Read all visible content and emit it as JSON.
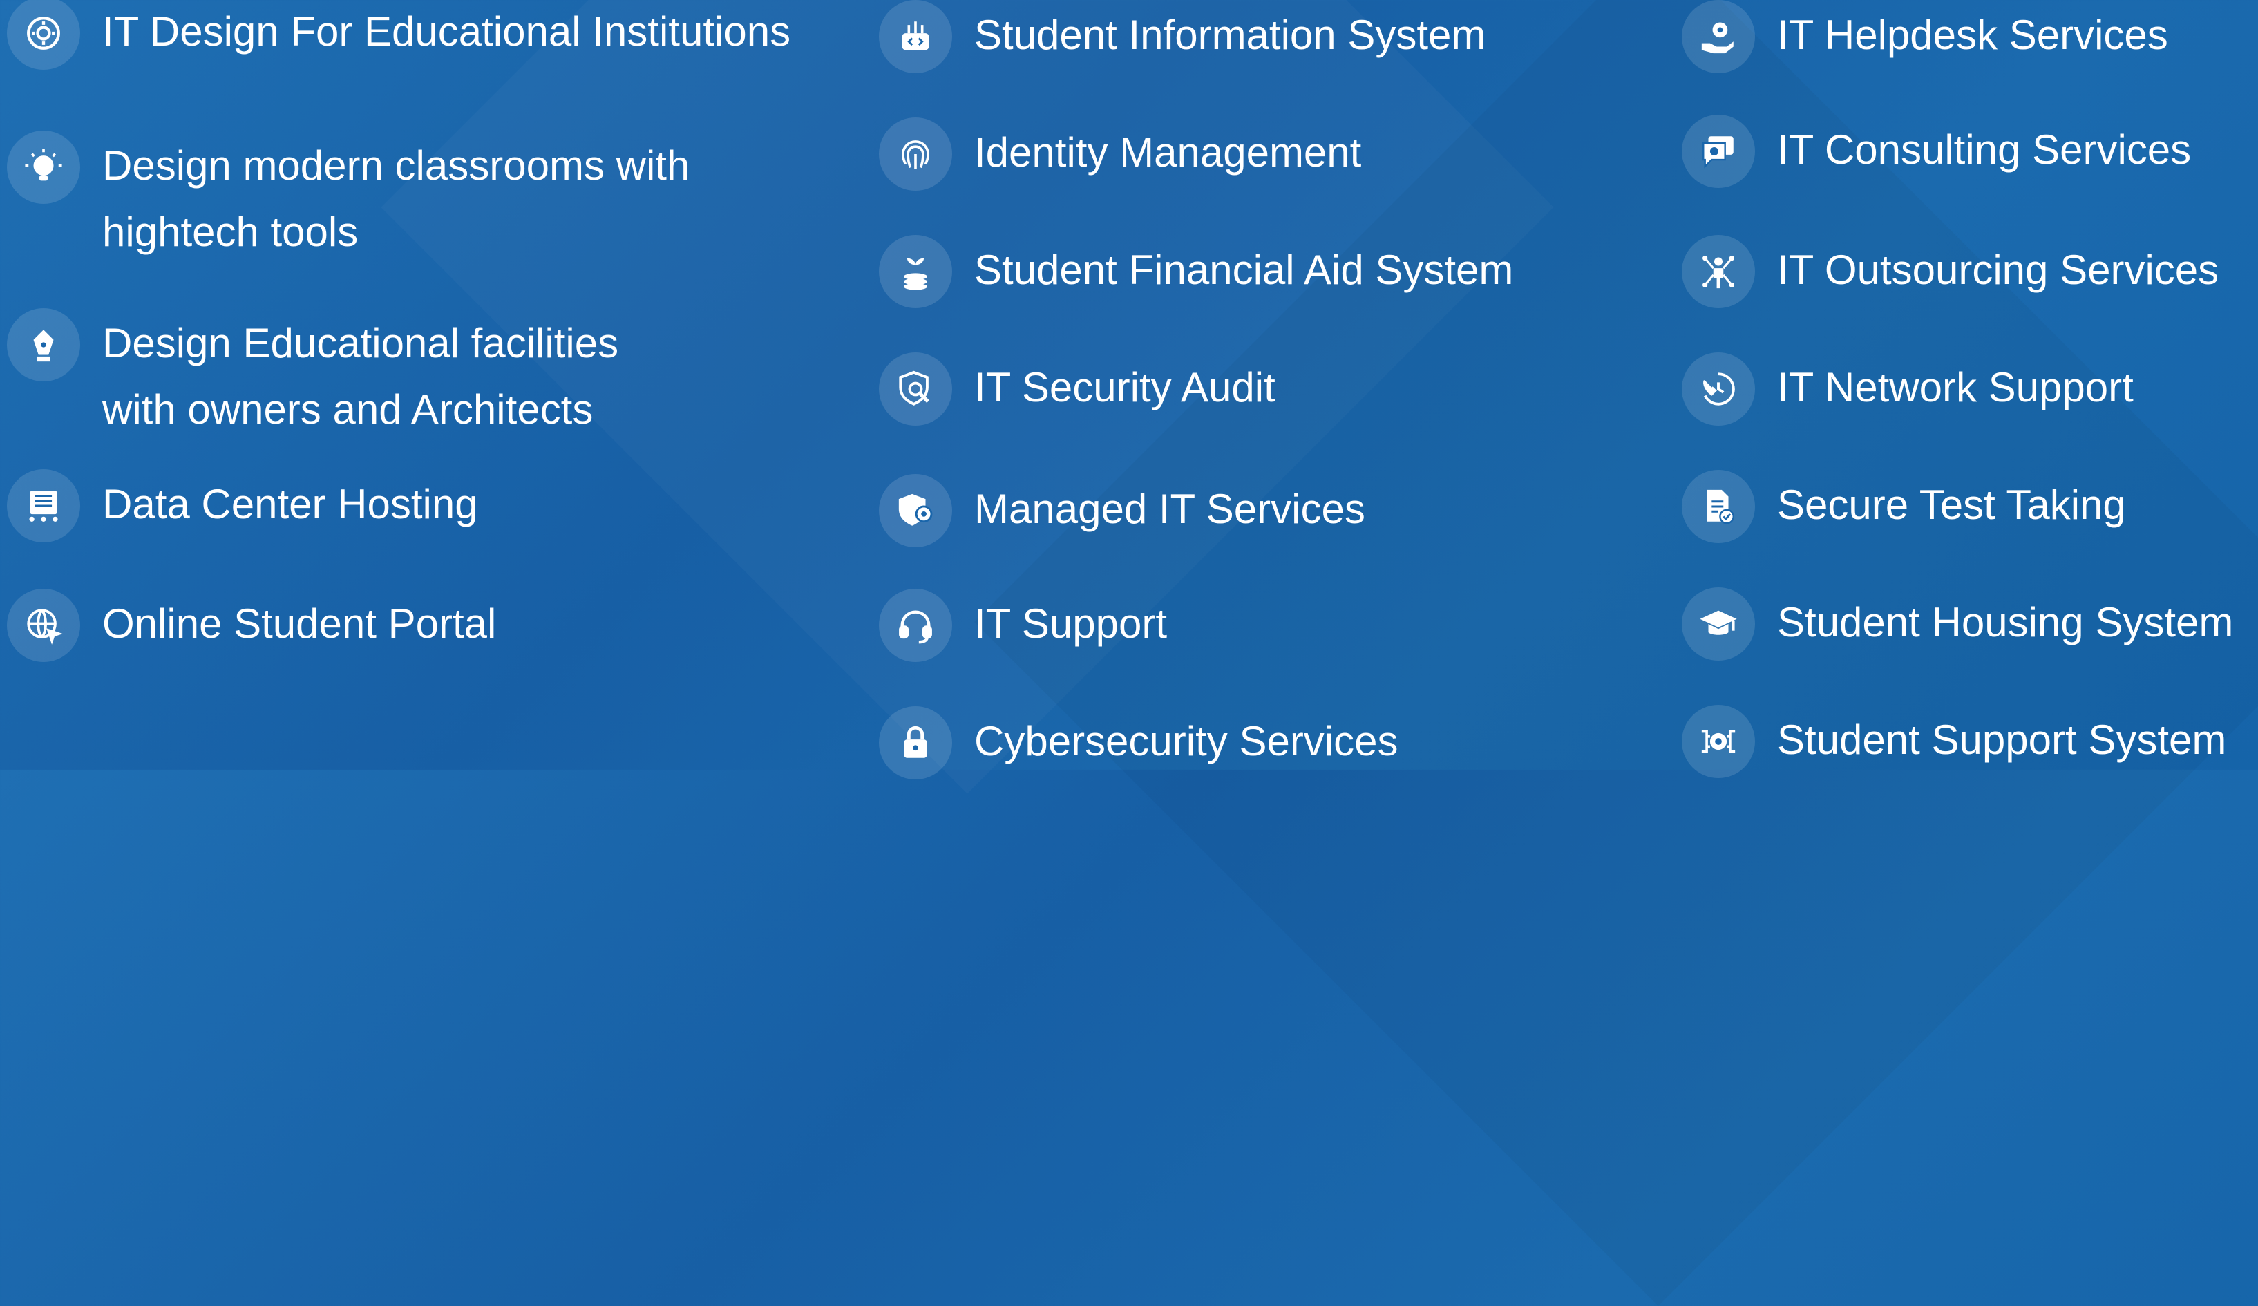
{
  "columns": [
    {
      "items": [
        {
          "label": "IT Design For Educational Institutions",
          "icon": "gear-cycle-icon"
        },
        {
          "label": "Design modern classrooms with\nhightech tools",
          "icon": "lightbulb-gear-icon"
        },
        {
          "label": "Design Educational  facilities\nwith owners and Architects",
          "icon": "pen-nib-icon"
        },
        {
          "label": "Data Center Hosting",
          "icon": "server-rack-icon"
        },
        {
          "label": "Online Student Portal",
          "icon": "globe-cursor-icon"
        }
      ]
    },
    {
      "items": [
        {
          "label": "Student Information System",
          "icon": "network-code-icon"
        },
        {
          "label": "Identity Management",
          "icon": "fingerprint-icon"
        },
        {
          "label": "Student Financial Aid System",
          "icon": "coins-plant-icon"
        },
        {
          "label": "IT Security Audit",
          "icon": "shield-search-icon"
        },
        {
          "label": "Managed IT Services",
          "icon": "shield-gear-icon"
        },
        {
          "label": "IT Support",
          "icon": "headset-icon"
        },
        {
          "label": "Cybersecurity Services",
          "icon": "lock-icon"
        }
      ]
    },
    {
      "items": [
        {
          "label": "IT Helpdesk Services",
          "icon": "hand-gear-icon"
        },
        {
          "label": "IT Consulting Services",
          "icon": "chat-gear-icon"
        },
        {
          "label": "IT Outsourcing Services",
          "icon": "person-network-icon"
        },
        {
          "label": "IT Network Support",
          "icon": "phone-clock-icon"
        },
        {
          "label": "Secure Test Taking",
          "icon": "document-check-icon"
        },
        {
          "label": "Student Housing System",
          "icon": "graduation-cap-icon"
        },
        {
          "label": "Student Support System",
          "icon": "gear-circuit-icon"
        }
      ]
    }
  ],
  "colors": {
    "background": "#1a66ab",
    "icon_circle": "rgba(255,255,255,0.13)",
    "text": "#ffffff"
  }
}
